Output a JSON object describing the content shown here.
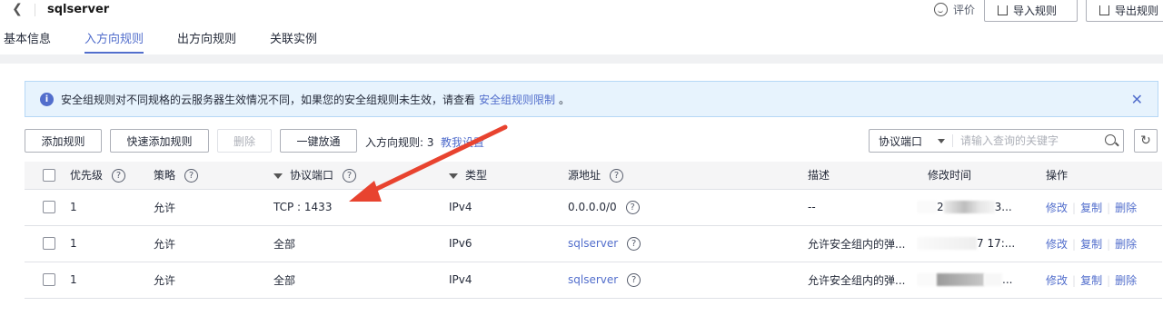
{
  "header": {
    "back_icon": "chevron-left-icon",
    "title": "sqlserver",
    "rate_label": "评价",
    "import_label": "导入规则",
    "export_label": "导出规则"
  },
  "tabs": [
    {
      "label": "基本信息",
      "active": false
    },
    {
      "label": "入方向规则",
      "active": true
    },
    {
      "label": "出方向规则",
      "active": false
    },
    {
      "label": "关联实例",
      "active": false
    }
  ],
  "notice": {
    "text": "安全组规则对不同规格的云服务器生效情况不同，如果您的安全组规则未生效，请查看",
    "link": "安全组规则限制",
    "suffix": "。"
  },
  "toolbar": {
    "add_label": "添加规则",
    "quick_add_label": "快速添加规则",
    "delete_label": "删除",
    "allow_all_label": "一键放通",
    "rule_count": "入方向规则: 3",
    "help_link": "教我设置",
    "filter_select": "协议端口",
    "search_placeholder": "请输入查询的关键字"
  },
  "table": {
    "headers": {
      "priority": "优先级",
      "policy": "策略",
      "port": "协议端口",
      "type": "类型",
      "source": "源地址",
      "desc": "描述",
      "modified": "修改时间",
      "ops": "操作"
    },
    "rows": [
      {
        "priority": "1",
        "policy": "允许",
        "port": "TCP : 1433",
        "type": "IPv4",
        "source": "0.0.0.0/0",
        "desc": "--",
        "modified_visible": "2",
        "modified_tail": "3..."
      },
      {
        "priority": "1",
        "policy": "允许",
        "port": "全部",
        "type": "IPv6",
        "source": "sqlserver",
        "desc": "允许安全组内的弹...",
        "modified_visible": "7 17:...",
        "modified_tail": ""
      },
      {
        "priority": "1",
        "policy": "允许",
        "port": "全部",
        "type": "IPv4",
        "source": "sqlserver",
        "desc": "允许安全组内的弹...",
        "modified_visible": "",
        "modified_tail": "..."
      }
    ],
    "op_modify": "修改",
    "op_copy": "复制",
    "op_delete": "删除",
    "op_sep": "|"
  },
  "colors": {
    "accent": "#526ecc",
    "arrow": "#e8432f",
    "notice_bg": "#e7f3fd"
  }
}
